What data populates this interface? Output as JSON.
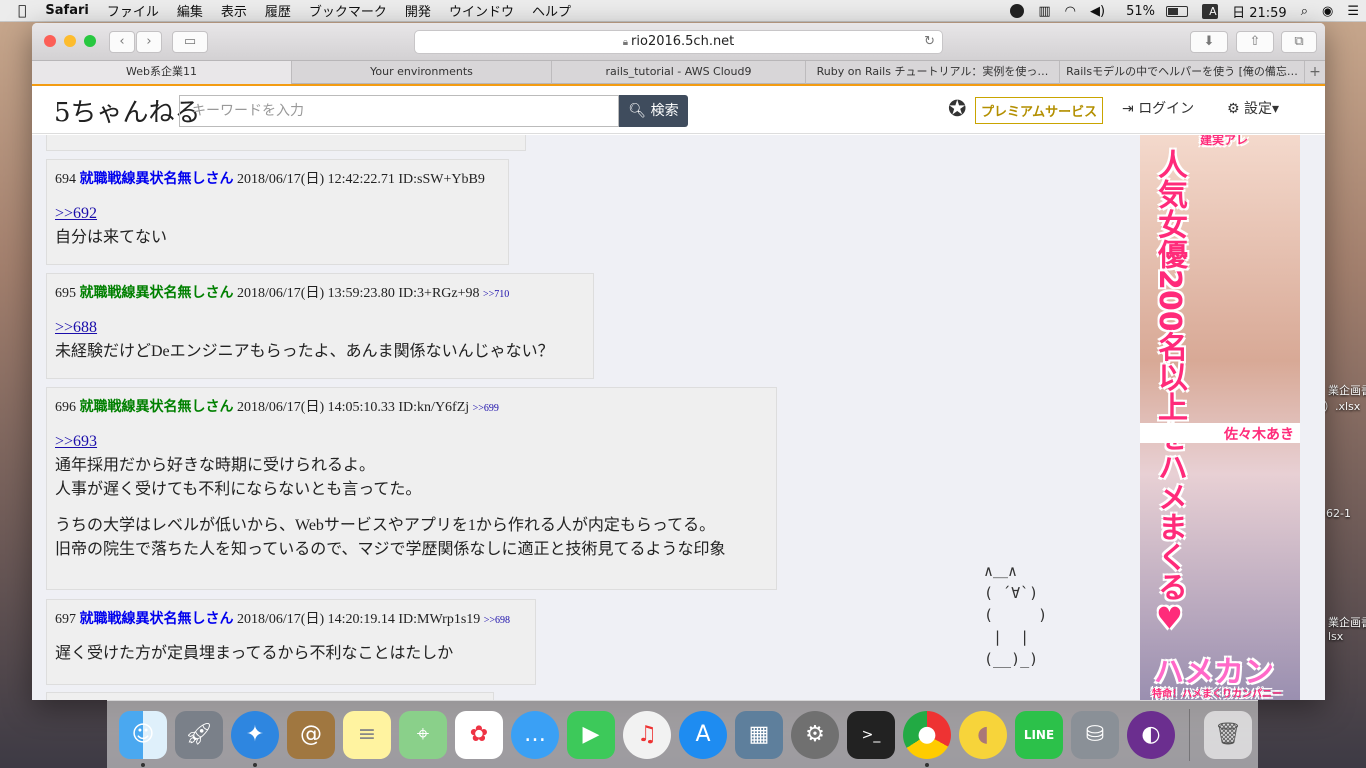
{
  "menubar": {
    "app": "Safari",
    "items": [
      "ファイル",
      "編集",
      "表示",
      "履歴",
      "ブックマーク",
      "開発",
      "ウインドウ",
      "ヘルプ"
    ],
    "battery": "51%",
    "input": "A",
    "clock": "日 21:59"
  },
  "browser": {
    "url": "rio2016.5ch.net",
    "tabs": [
      "Web系企業11",
      "Your environments",
      "rails_tutorial - AWS Cloud9",
      "Ruby on Rails チュートリアル：実例を使っ…",
      "Railsモデルの中でヘルパーを使う [俺の備忘…"
    ]
  },
  "site": {
    "logo": "5ちゃんねる",
    "search_placeholder": "キーワードを入力",
    "search_button": "検索",
    "premium": "プレミアムサービス",
    "login": "ログイン",
    "settings": "設定"
  },
  "posts": [
    {
      "num": "694",
      "name": "就職戦線異状名無しさん",
      "date": "2018/06/17(日) 12:42:22.71",
      "id": "ID:sSW+YbB9",
      "reply_ref": "",
      "anchor": ">>692",
      "lines": [
        "自分は来てない"
      ]
    },
    {
      "num": "695",
      "name": "就職戦線異状名無しさん",
      "date": "2018/06/17(日) 13:59:23.80",
      "id": "ID:3+RGz+98",
      "reply_ref": ">>710",
      "anchor": ">>688",
      "lines": [
        "未経験だけどDeエンジニアもらったよ、あんま関係ないんじゃない？"
      ]
    },
    {
      "num": "696",
      "name": "就職戦線異状名無しさん",
      "date": "2018/06/17(日) 14:05:10.33",
      "id": "ID:kn/Y6fZj",
      "reply_ref": ">>699",
      "anchor": ">>693",
      "lines": [
        "通年採用だから好きな時期に受けられるよ。",
        "人事が遅く受けても不利にならないとも言ってた。",
        "",
        "うちの大学はレベルが低いから、Webサービスやアプリを1から作れる人が内定もらってる。",
        "旧帝の院生で落ちた人を知っているので、マジで学歴関係なしに適正と技術見てるような印象"
      ]
    },
    {
      "num": "697",
      "name": "就職戦線異状名無しさん",
      "date": "2018/06/17(日) 14:20:19.14",
      "id": "ID:MWrp1s19",
      "reply_ref": ">>698",
      "anchor": "",
      "lines": [
        "遅く受けた方が定員埋まってるから不利なことはたしか"
      ]
    }
  ],
  "ad": {
    "top_text": "人気女優200名以上をハメまくる♥",
    "name_top": "建実アレ",
    "name_mid": "佐々木あき",
    "brand": "ハメカン",
    "brand_sub": "特命！ハメまくりカンパニー"
  },
  "ascii_art": "∧＿∧\n( ´∀`)\n(     )\n |  |\n(__)_)",
  "desktop_files": [
    "業企画書",
    "）.xlsx",
    "62-1",
    "業企画書",
    "lsx"
  ],
  "dock": [
    "Finder",
    "Launchpad",
    "Safari",
    "Contacts",
    "Notes",
    "Maps",
    "Photos",
    "Messages",
    "FaceTime",
    "iTunes",
    "App Store",
    "Preview",
    "System Preferences",
    "Terminal",
    "Chrome",
    "Cyberduck",
    "LINE",
    "Sequel",
    "GitHub",
    "Trash"
  ]
}
